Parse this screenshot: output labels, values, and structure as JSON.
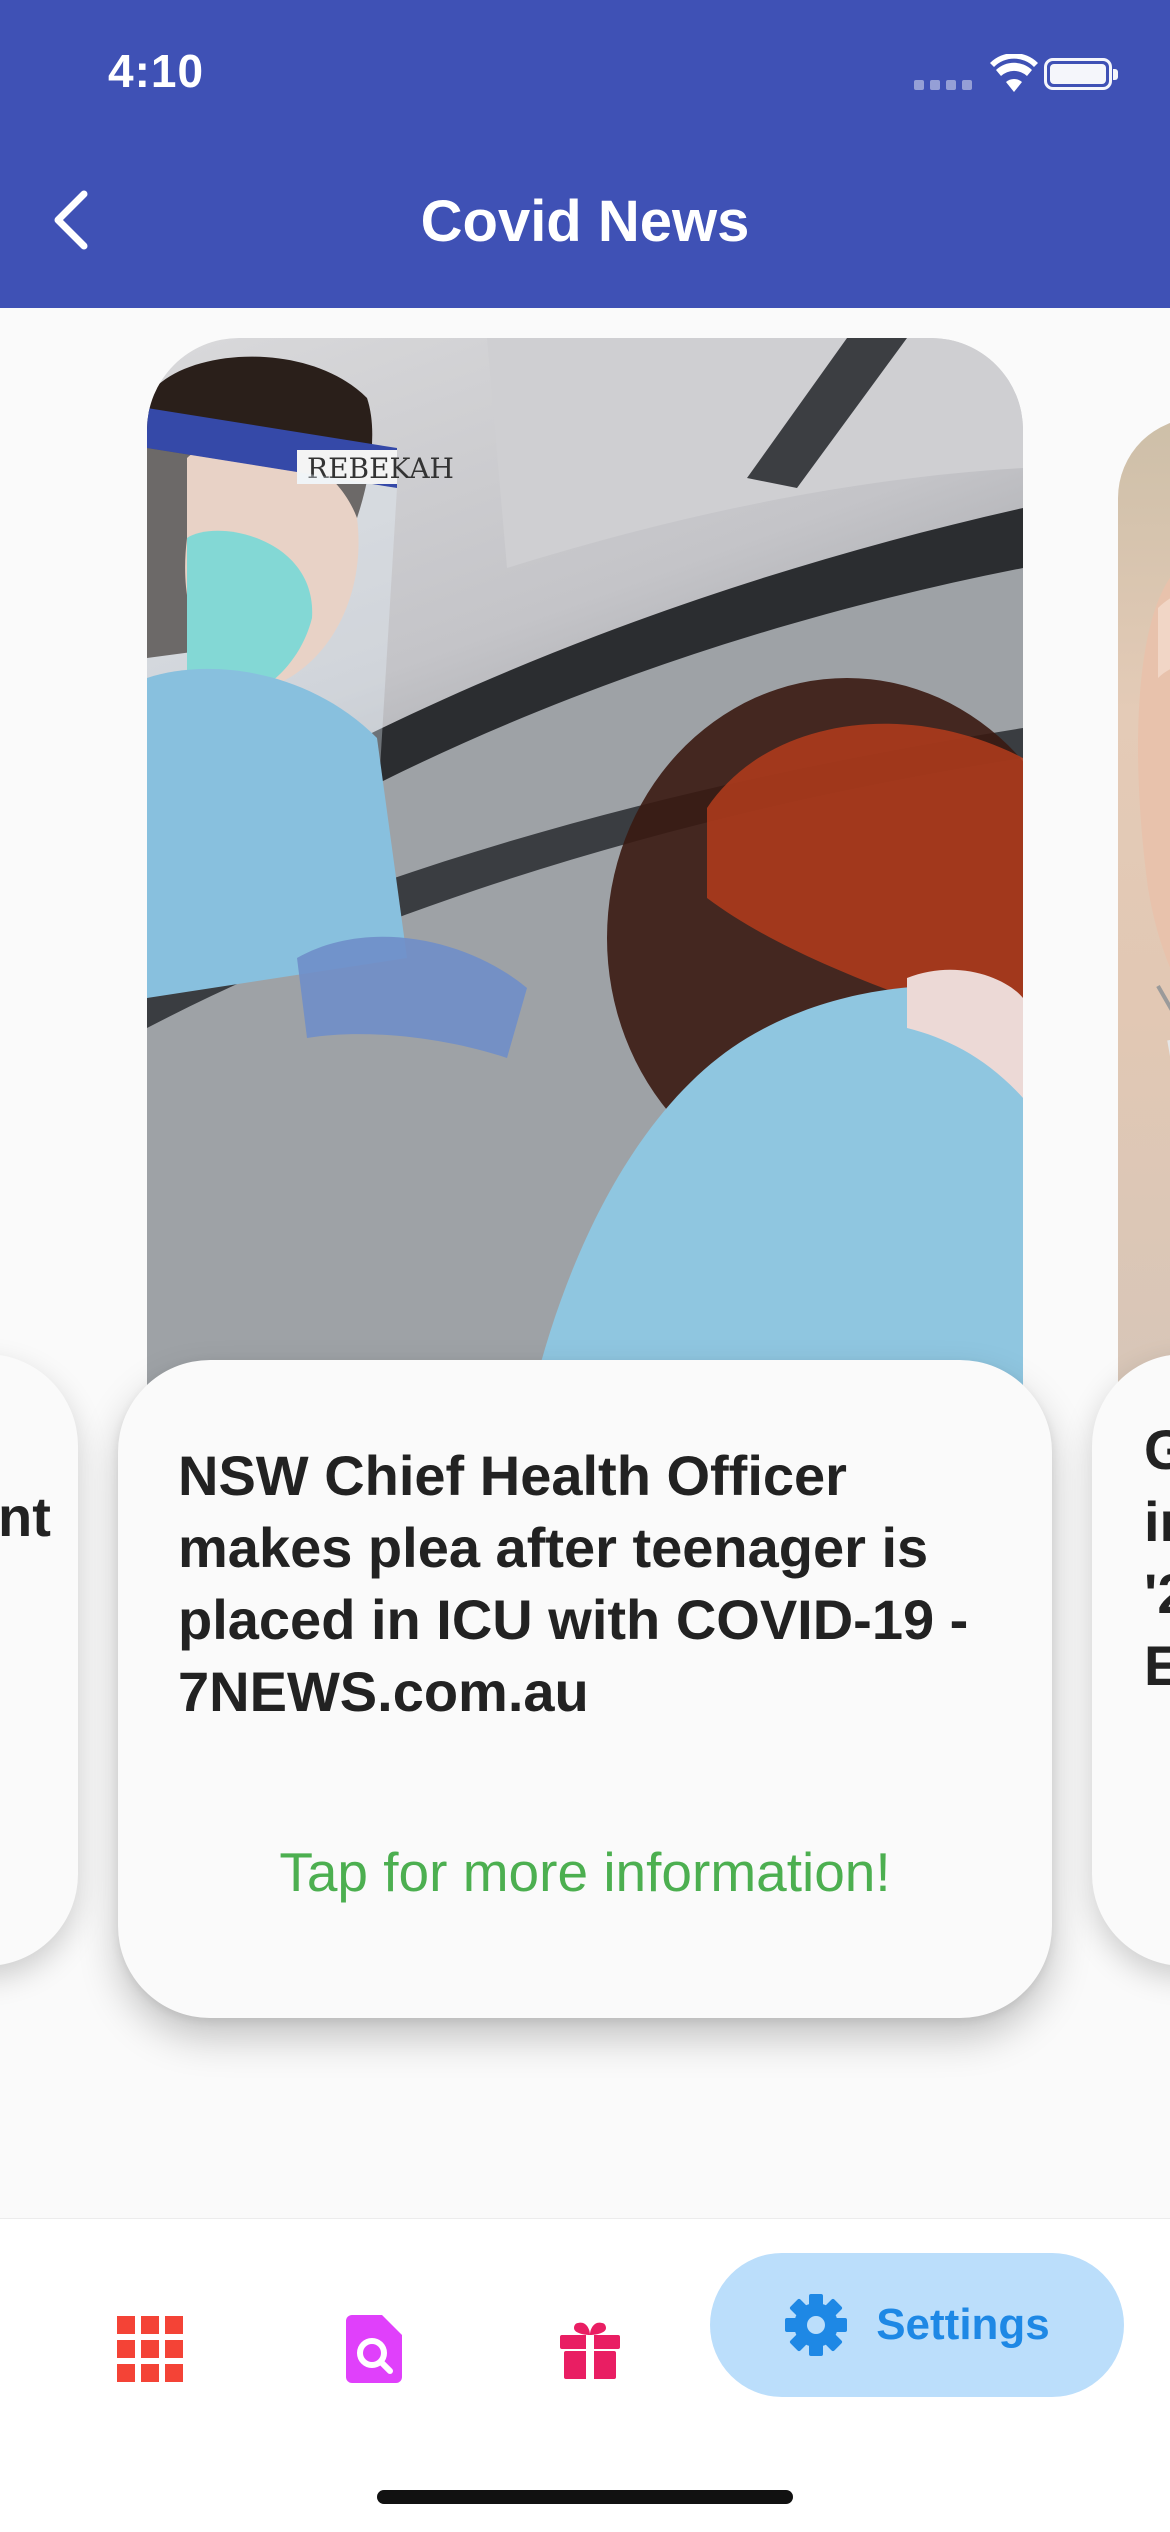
{
  "status_bar": {
    "time": "4:10"
  },
  "appbar": {
    "title": "Covid News"
  },
  "carousel": {
    "current": {
      "headline": "NSW Chief Health Officer makes plea after teenager is placed in ICU with COVID-19 - 7NEWS.com.au",
      "cta": "Tap for more information!",
      "shield_text": "REBEKAH"
    },
    "previous_peek": {
      "visible_text": "nt"
    },
    "next_peek": {
      "visible_lines": [
        "G",
        "ir",
        "'2",
        "E"
      ]
    }
  },
  "bottom_nav": {
    "items": [
      {
        "icon": "apps-grid-icon",
        "label": ""
      },
      {
        "icon": "document-search-icon",
        "label": ""
      },
      {
        "icon": "gift-icon",
        "label": ""
      },
      {
        "icon": "gear-icon",
        "label": "Settings",
        "selected": true
      }
    ]
  },
  "colors": {
    "appbar": "#3f51b5",
    "cta_green": "#4caf50",
    "nav_home": "#f44336",
    "nav_search": "#e040fb",
    "nav_gift": "#e91e63",
    "nav_settings": "#1e88e5",
    "nav_settings_bg": "#bbdefb"
  }
}
